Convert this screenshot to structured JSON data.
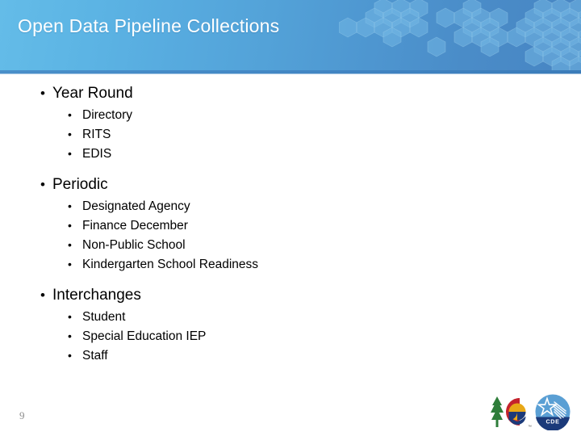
{
  "slide": {
    "page_number": "9",
    "title": "Open Data Pipeline Collections",
    "background_color": "#ffffff"
  },
  "header": {
    "title": "Open Data Pipeline Collections",
    "gradient_start": "#64bce8",
    "gradient_end": "#4785c3",
    "rule_color": "#4489c6",
    "hexagon_color": "#6fb4e2",
    "title_color": "#ffffff"
  },
  "content": {
    "groups": [
      {
        "label": "Year Round",
        "items": [
          {
            "label": "Directory"
          },
          {
            "label": "RITS"
          },
          {
            "label": "EDIS"
          }
        ]
      },
      {
        "label": "Periodic",
        "items": [
          {
            "label": "Designated Agency"
          },
          {
            "label": "Finance December"
          },
          {
            "label": "Non-Public School"
          },
          {
            "label": "Kindergarten School Readiness"
          }
        ]
      },
      {
        "label": "Interchanges",
        "items": [
          {
            "label": "Student"
          },
          {
            "label": "Special Education IEP"
          },
          {
            "label": "Staff"
          }
        ]
      }
    ],
    "bullet_glyph_level1": "•",
    "bullet_glyph_level2": "•",
    "text_color": "#000000"
  },
  "footer": {
    "page_number": "9",
    "page_number_color": "#8d8d8d",
    "logos": [
      {
        "name": "colorado-state-logo",
        "colors": [
          "#2e7d3a",
          "#c4232d",
          "#e8a817",
          "#1b3a7a"
        ]
      },
      {
        "name": "cde-logo",
        "colors": [
          "#5a9fd4",
          "#1b3a7a",
          "#ffffff"
        ],
        "text": "CDE"
      }
    ]
  }
}
